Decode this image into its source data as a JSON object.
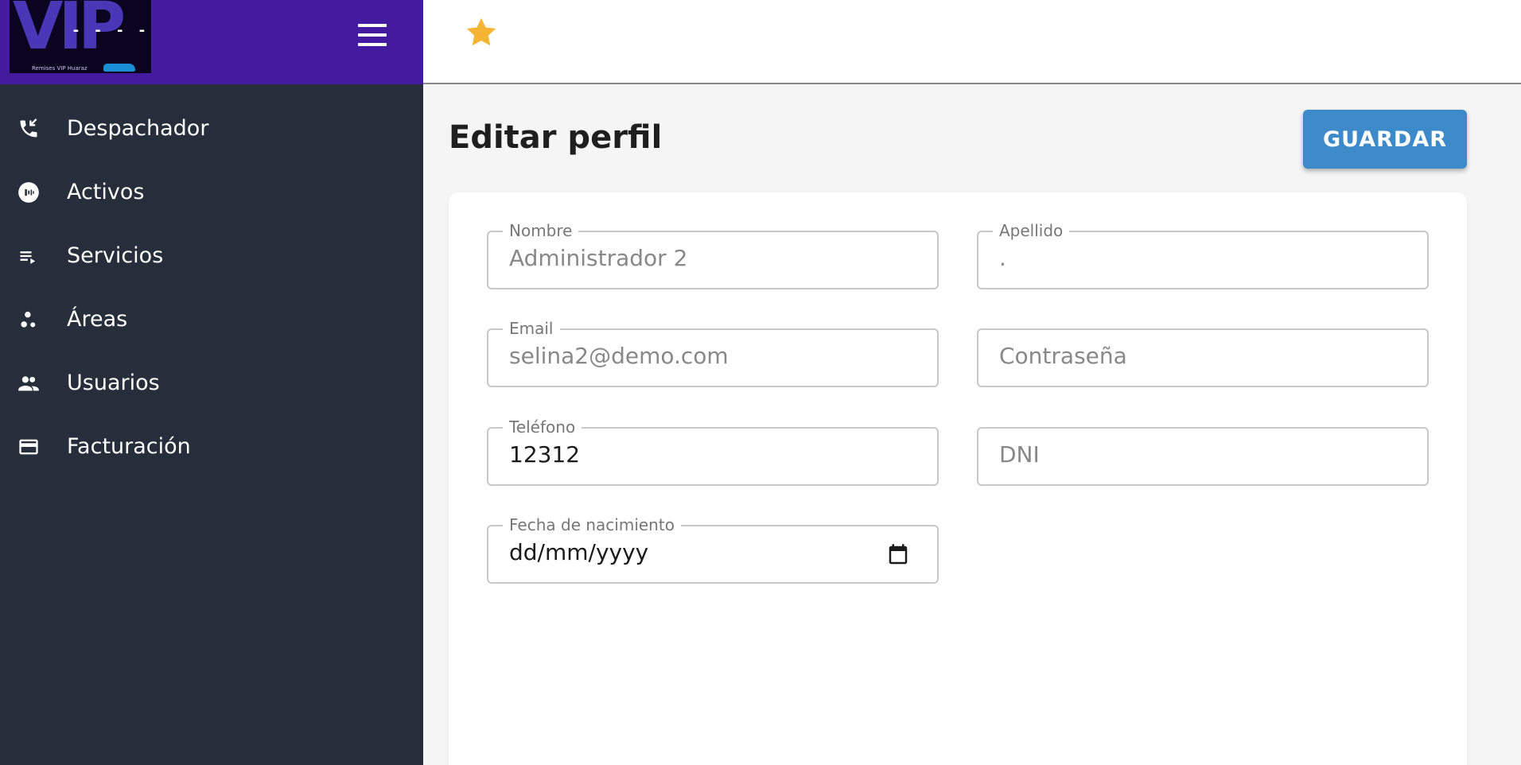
{
  "sidebar": {
    "logo": {
      "mark": "VIP",
      "dashes": "- - - -",
      "text": "Remises VIP Huaraz"
    },
    "items": [
      {
        "label": "Despachador",
        "icon": "phone-callback-icon"
      },
      {
        "label": "Activos",
        "icon": "active-nfc-icon"
      },
      {
        "label": "Servicios",
        "icon": "playlist-icon"
      },
      {
        "label": "Áreas",
        "icon": "bubbles-icon"
      },
      {
        "label": "Usuarios",
        "icon": "people-icon"
      },
      {
        "label": "Facturación",
        "icon": "credit-card-icon"
      }
    ]
  },
  "topbar": {
    "star_icon": "star-icon"
  },
  "main": {
    "title": "Editar perfil",
    "save_label": "GUARDAR"
  },
  "form": {
    "nombre": {
      "label": "Nombre",
      "value": "Administrador 2"
    },
    "apellido": {
      "label": "Apellido",
      "value": "."
    },
    "email": {
      "label": "Email",
      "value": "selina2@demo.com"
    },
    "password": {
      "placeholder": "Contraseña"
    },
    "telefono": {
      "label": "Teléfono",
      "value": "12312"
    },
    "dni": {
      "placeholder": "DNI"
    },
    "fecha": {
      "label": "Fecha de nacimiento",
      "value": "dd/mm/yyyy"
    }
  },
  "colors": {
    "sidebar_bg": "#272e3b",
    "header_bg": "#441a9e",
    "accent": "#3c8ac9",
    "star": "#f5b433"
  }
}
